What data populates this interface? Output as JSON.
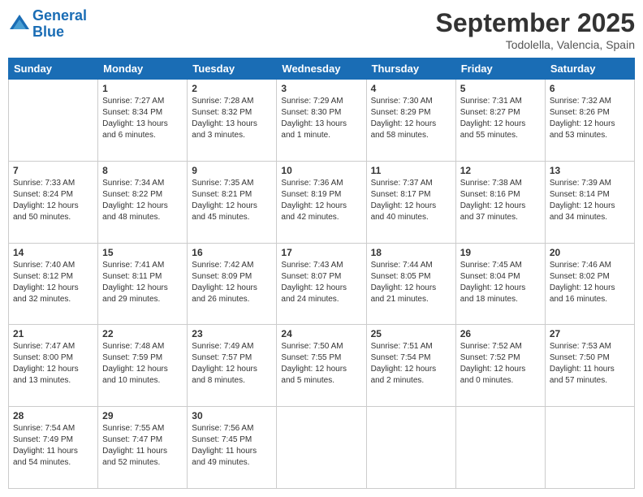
{
  "header": {
    "logo_line1": "General",
    "logo_line2": "Blue",
    "month": "September 2025",
    "location": "Todolella, Valencia, Spain"
  },
  "weekdays": [
    "Sunday",
    "Monday",
    "Tuesday",
    "Wednesday",
    "Thursday",
    "Friday",
    "Saturday"
  ],
  "weeks": [
    [
      {
        "day": "",
        "info": ""
      },
      {
        "day": "1",
        "info": "Sunrise: 7:27 AM\nSunset: 8:34 PM\nDaylight: 13 hours\nand 6 minutes."
      },
      {
        "day": "2",
        "info": "Sunrise: 7:28 AM\nSunset: 8:32 PM\nDaylight: 13 hours\nand 3 minutes."
      },
      {
        "day": "3",
        "info": "Sunrise: 7:29 AM\nSunset: 8:30 PM\nDaylight: 13 hours\nand 1 minute."
      },
      {
        "day": "4",
        "info": "Sunrise: 7:30 AM\nSunset: 8:29 PM\nDaylight: 12 hours\nand 58 minutes."
      },
      {
        "day": "5",
        "info": "Sunrise: 7:31 AM\nSunset: 8:27 PM\nDaylight: 12 hours\nand 55 minutes."
      },
      {
        "day": "6",
        "info": "Sunrise: 7:32 AM\nSunset: 8:26 PM\nDaylight: 12 hours\nand 53 minutes."
      }
    ],
    [
      {
        "day": "7",
        "info": "Sunrise: 7:33 AM\nSunset: 8:24 PM\nDaylight: 12 hours\nand 50 minutes."
      },
      {
        "day": "8",
        "info": "Sunrise: 7:34 AM\nSunset: 8:22 PM\nDaylight: 12 hours\nand 48 minutes."
      },
      {
        "day": "9",
        "info": "Sunrise: 7:35 AM\nSunset: 8:21 PM\nDaylight: 12 hours\nand 45 minutes."
      },
      {
        "day": "10",
        "info": "Sunrise: 7:36 AM\nSunset: 8:19 PM\nDaylight: 12 hours\nand 42 minutes."
      },
      {
        "day": "11",
        "info": "Sunrise: 7:37 AM\nSunset: 8:17 PM\nDaylight: 12 hours\nand 40 minutes."
      },
      {
        "day": "12",
        "info": "Sunrise: 7:38 AM\nSunset: 8:16 PM\nDaylight: 12 hours\nand 37 minutes."
      },
      {
        "day": "13",
        "info": "Sunrise: 7:39 AM\nSunset: 8:14 PM\nDaylight: 12 hours\nand 34 minutes."
      }
    ],
    [
      {
        "day": "14",
        "info": "Sunrise: 7:40 AM\nSunset: 8:12 PM\nDaylight: 12 hours\nand 32 minutes."
      },
      {
        "day": "15",
        "info": "Sunrise: 7:41 AM\nSunset: 8:11 PM\nDaylight: 12 hours\nand 29 minutes."
      },
      {
        "day": "16",
        "info": "Sunrise: 7:42 AM\nSunset: 8:09 PM\nDaylight: 12 hours\nand 26 minutes."
      },
      {
        "day": "17",
        "info": "Sunrise: 7:43 AM\nSunset: 8:07 PM\nDaylight: 12 hours\nand 24 minutes."
      },
      {
        "day": "18",
        "info": "Sunrise: 7:44 AM\nSunset: 8:05 PM\nDaylight: 12 hours\nand 21 minutes."
      },
      {
        "day": "19",
        "info": "Sunrise: 7:45 AM\nSunset: 8:04 PM\nDaylight: 12 hours\nand 18 minutes."
      },
      {
        "day": "20",
        "info": "Sunrise: 7:46 AM\nSunset: 8:02 PM\nDaylight: 12 hours\nand 16 minutes."
      }
    ],
    [
      {
        "day": "21",
        "info": "Sunrise: 7:47 AM\nSunset: 8:00 PM\nDaylight: 12 hours\nand 13 minutes."
      },
      {
        "day": "22",
        "info": "Sunrise: 7:48 AM\nSunset: 7:59 PM\nDaylight: 12 hours\nand 10 minutes."
      },
      {
        "day": "23",
        "info": "Sunrise: 7:49 AM\nSunset: 7:57 PM\nDaylight: 12 hours\nand 8 minutes."
      },
      {
        "day": "24",
        "info": "Sunrise: 7:50 AM\nSunset: 7:55 PM\nDaylight: 12 hours\nand 5 minutes."
      },
      {
        "day": "25",
        "info": "Sunrise: 7:51 AM\nSunset: 7:54 PM\nDaylight: 12 hours\nand 2 minutes."
      },
      {
        "day": "26",
        "info": "Sunrise: 7:52 AM\nSunset: 7:52 PM\nDaylight: 12 hours\nand 0 minutes."
      },
      {
        "day": "27",
        "info": "Sunrise: 7:53 AM\nSunset: 7:50 PM\nDaylight: 11 hours\nand 57 minutes."
      }
    ],
    [
      {
        "day": "28",
        "info": "Sunrise: 7:54 AM\nSunset: 7:49 PM\nDaylight: 11 hours\nand 54 minutes."
      },
      {
        "day": "29",
        "info": "Sunrise: 7:55 AM\nSunset: 7:47 PM\nDaylight: 11 hours\nand 52 minutes."
      },
      {
        "day": "30",
        "info": "Sunrise: 7:56 AM\nSunset: 7:45 PM\nDaylight: 11 hours\nand 49 minutes."
      },
      {
        "day": "",
        "info": ""
      },
      {
        "day": "",
        "info": ""
      },
      {
        "day": "",
        "info": ""
      },
      {
        "day": "",
        "info": ""
      }
    ]
  ]
}
